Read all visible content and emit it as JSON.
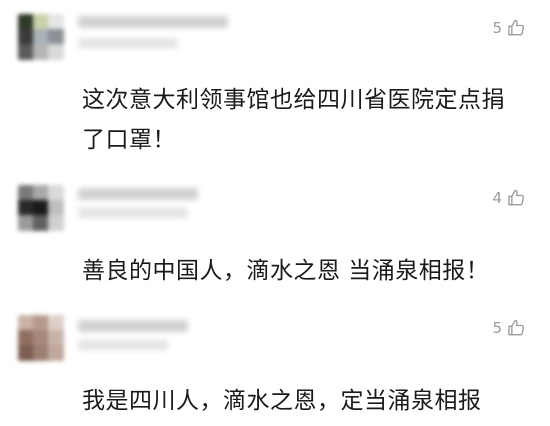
{
  "comments": [
    {
      "likes": "5",
      "text": "这次意大利领事馆也给四川省医院定点捐了口罩！",
      "avatar_colors": [
        "#2e3a2a",
        "#c9d1a8",
        "#e6e6e6",
        "#3b3b3b",
        "#a9b3b8",
        "#8b9196",
        "#5a5a5a",
        "#b5b5b5",
        "#d9d9d9"
      ]
    },
    {
      "likes": "4",
      "text": "善良的中国人，滴水之恩 当涌泉相报！",
      "avatar_colors": [
        "#7a7a7a",
        "#a9a9a9",
        "#d9d9d9",
        "#2a2a2a",
        "#1a1a1a",
        "#bfbfbf",
        "#9a9a9a",
        "#606060",
        "#d0d0d0"
      ]
    },
    {
      "likes": "5",
      "text": "我是四川人，滴水之恩，定当涌泉相报",
      "avatar_colors": [
        "#c9b2a6",
        "#b59a8c",
        "#ddd0c8",
        "#8f6f60",
        "#a8887a",
        "#c7b3a8",
        "#7d5f52",
        "#9c7f72",
        "#bfa89d"
      ]
    }
  ],
  "icons": {
    "like": "thumbs-up-icon"
  },
  "colors": {
    "text": "#1a1a1a",
    "meta": "#9a9a9a",
    "background": "#ffffff"
  }
}
